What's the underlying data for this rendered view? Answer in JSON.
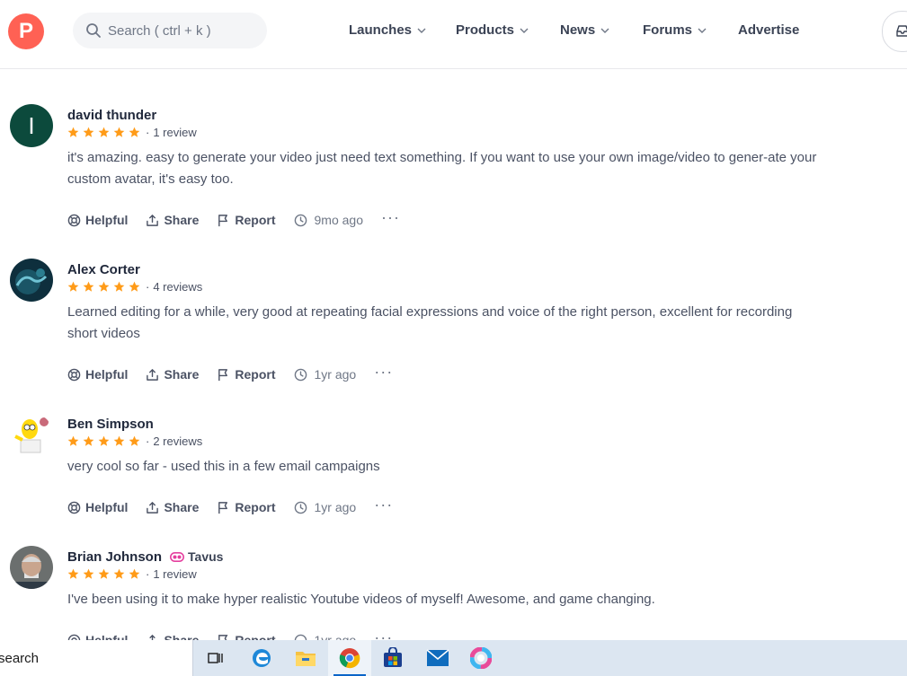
{
  "header": {
    "logo_letter": "P",
    "search_placeholder": "Search ( ctrl + k )",
    "nav": [
      {
        "label": "Launches",
        "has_dropdown": true
      },
      {
        "label": "Products",
        "has_dropdown": true
      },
      {
        "label": "News",
        "has_dropdown": true
      },
      {
        "label": "Forums",
        "has_dropdown": true
      },
      {
        "label": "Advertise",
        "has_dropdown": false
      }
    ]
  },
  "reviews": [
    {
      "avatar_letter": "I",
      "avatar_color": "#0c4a3c",
      "name": "david thunder",
      "rating": 5,
      "review_count": "1 review",
      "text": "it's amazing. easy to generate your video just need text something. If you want to use your own image/video to gener-ate your custom avatar, it's easy too.",
      "time": "9mo ago"
    },
    {
      "name": "Alex Corter",
      "rating": 5,
      "review_count": "4 reviews",
      "text": "Learned editing for a while, very good at repeating facial expressions and voice of the right person, excellent for recording short videos",
      "time": "1yr ago"
    },
    {
      "name": "Ben Simpson",
      "rating": 5,
      "review_count": "2 reviews",
      "text": "very cool so far - used this in a few email campaigns",
      "time": "1yr ago"
    },
    {
      "name": "Brian Johnson",
      "maker_badge": "Tavus",
      "rating": 5,
      "review_count": "1 review",
      "text": "I've been using it to make hyper realistic Youtube videos of myself! Awesome, and game changing.",
      "time": "1yr ago"
    }
  ],
  "actions": {
    "helpful": "Helpful",
    "share": "Share",
    "report": "Report",
    "more": "···"
  },
  "colors": {
    "brand": "#ff6154",
    "star": "#ff9b18",
    "maker_badge": "#e5409f"
  },
  "taskbar": {
    "search_text": "search",
    "apps": [
      "task-view-icon",
      "edge-icon",
      "file-explorer-icon",
      "chrome-icon",
      "store-icon",
      "mail-icon",
      "copilot-icon"
    ]
  }
}
